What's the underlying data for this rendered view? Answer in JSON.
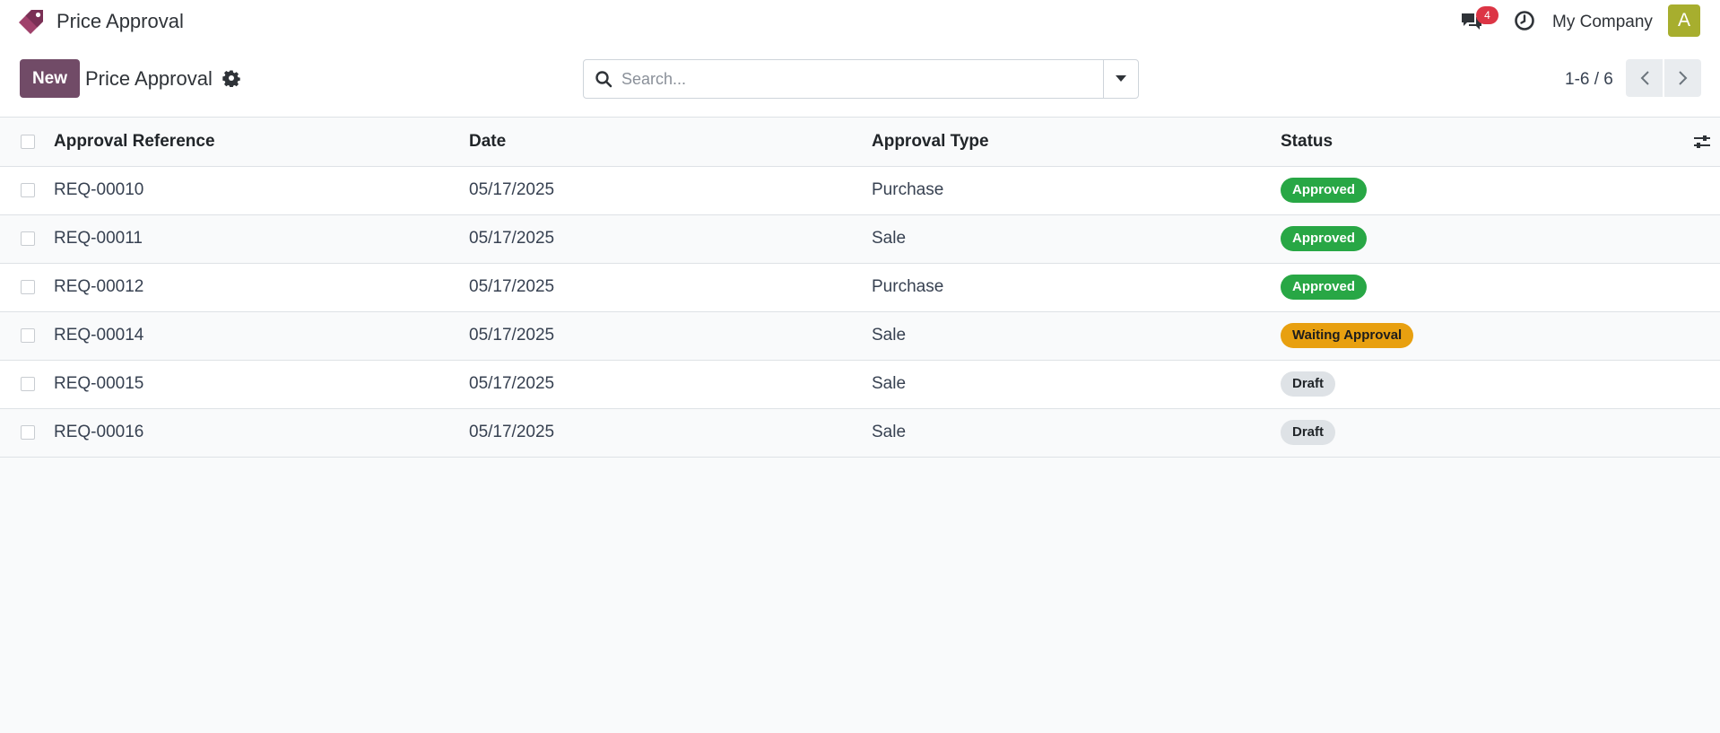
{
  "header": {
    "app_name": "Price Approval",
    "messages_count": "4",
    "company": "My Company",
    "avatar_letter": "A"
  },
  "controlbar": {
    "new_label": "New",
    "title": "Price Approval",
    "search_placeholder": "Search...",
    "pager": "1-6 / 6"
  },
  "table": {
    "columns": [
      "Approval Reference",
      "Date",
      "Approval Type",
      "Status"
    ],
    "rows": [
      {
        "ref": "REQ-00010",
        "date": "05/17/2025",
        "type": "Purchase",
        "status": "Approved"
      },
      {
        "ref": "REQ-00011",
        "date": "05/17/2025",
        "type": "Sale",
        "status": "Approved"
      },
      {
        "ref": "REQ-00012",
        "date": "05/17/2025",
        "type": "Purchase",
        "status": "Approved"
      },
      {
        "ref": "REQ-00014",
        "date": "05/17/2025",
        "type": "Sale",
        "status": "Waiting Approval"
      },
      {
        "ref": "REQ-00015",
        "date": "05/17/2025",
        "type": "Sale",
        "status": "Draft"
      },
      {
        "ref": "REQ-00016",
        "date": "05/17/2025",
        "type": "Sale",
        "status": "Draft"
      }
    ]
  },
  "colors": {
    "brand": "#714b67",
    "approved": "#28a745",
    "waiting": "#e8a010",
    "draft": "#dee2e6",
    "notification": "#dc3545",
    "avatar": "#a7ae2e"
  },
  "icons": {
    "logo": "price-tag-icon",
    "messages": "chat-bubbles-icon",
    "activities": "clock-icon",
    "settings": "gear-icon",
    "search": "search-icon",
    "search_toggle": "caret-down-icon",
    "pager_prev": "chevron-left-icon",
    "pager_next": "chevron-right-icon",
    "optional_columns": "sliders-icon"
  }
}
